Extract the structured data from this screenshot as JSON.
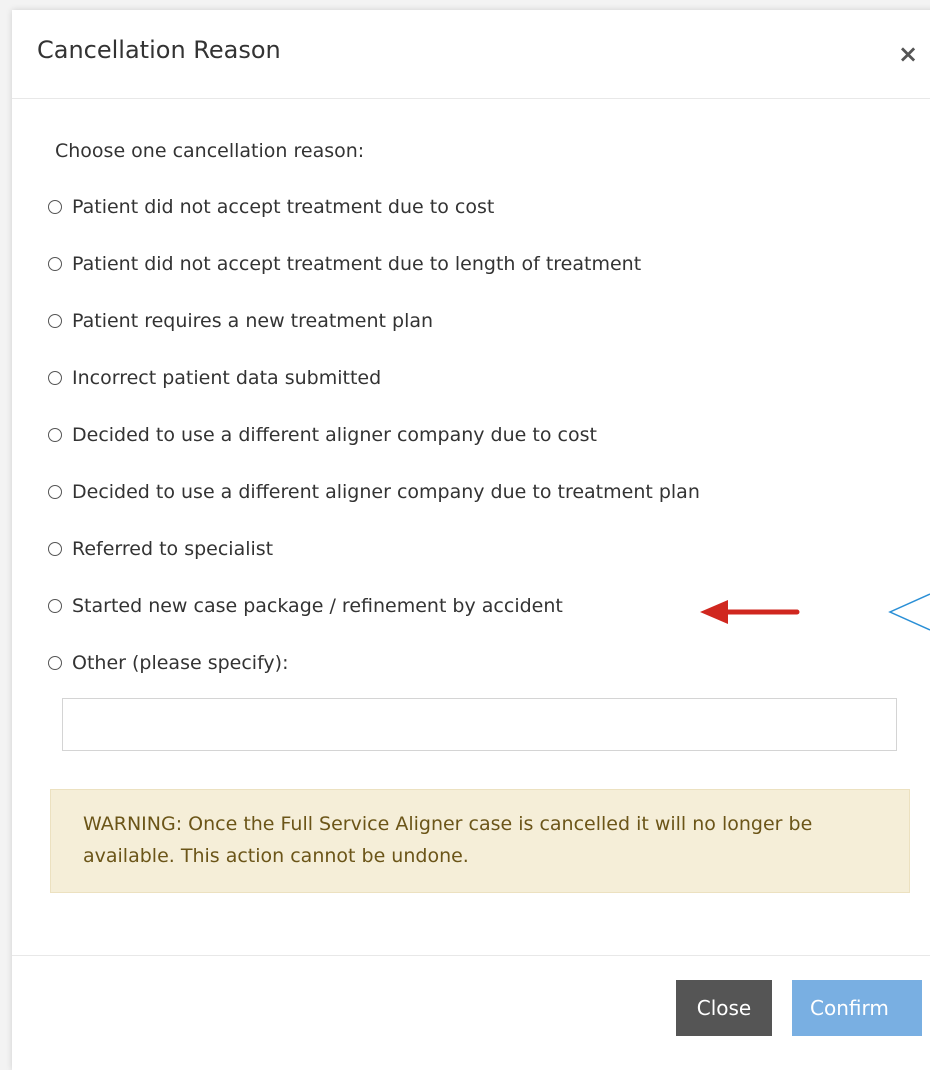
{
  "dialog": {
    "title": "Cancellation Reason",
    "close_icon": "×",
    "prompt": "Choose one cancellation reason:",
    "options": [
      "Patient did not accept treatment due to cost",
      "Patient did not accept treatment due to length of treatment",
      "Patient requires a new treatment plan",
      "Incorrect patient data submitted",
      "Decided to use a different aligner company due to cost",
      "Decided to use a different aligner company due to treatment plan",
      "Referred to specialist",
      "Started new case package / refinement by accident",
      "Other (please specify):"
    ],
    "other_input_value": "",
    "warning": "WARNING: Once the Full Service Aligner case is cancelled it will no longer be available. This action cannot be undone.",
    "close_label": "Close",
    "confirm_label": "Confirm"
  },
  "colors": {
    "warning_bg": "#f5eed8",
    "warning_text": "#6b5518",
    "close_button": "#555555",
    "confirm_button": "#79afe2",
    "annotation_arrow": "#d0271f",
    "annotation_callout": "#2a8fd6"
  }
}
